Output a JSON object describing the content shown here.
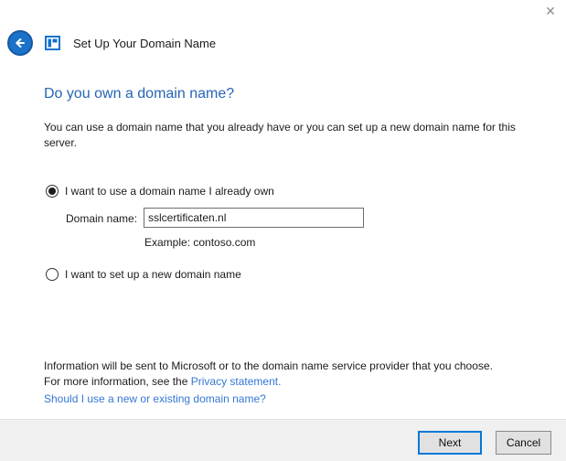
{
  "window": {
    "icons": {
      "close": "✕"
    }
  },
  "header": {
    "title": "Set Up Your Domain Name"
  },
  "main": {
    "heading": "Do you own a domain name?",
    "intro": "You can use a domain name that you already have or you can set up a new domain name for this server.",
    "option_own": {
      "label": "I want to use a domain name I already own",
      "selected": true
    },
    "domain_field": {
      "label": "Domain name:",
      "value": "sslcertificaten.nl",
      "example": "Example: contoso.com"
    },
    "option_new": {
      "label": "I want to set up a new domain name",
      "selected": false
    },
    "info_line1": "Information will be sent to Microsoft or to the domain name service provider that you choose.",
    "info_line2_prefix": "For more information, see the ",
    "privacy_link_label": "Privacy statement",
    "info_line2_suffix": ".",
    "question_link_label": "Should I use a new or existing domain name?"
  },
  "footer": {
    "next_label": "Next",
    "cancel_label": "Cancel"
  },
  "colors": {
    "heading_blue": "#2565b5",
    "link_blue": "#3577d4",
    "accent_blue": "#0078d7",
    "back_button_blue": "#1b72ca",
    "footer_gray": "#f0f0f0",
    "button_gray": "#e1e1e1"
  }
}
